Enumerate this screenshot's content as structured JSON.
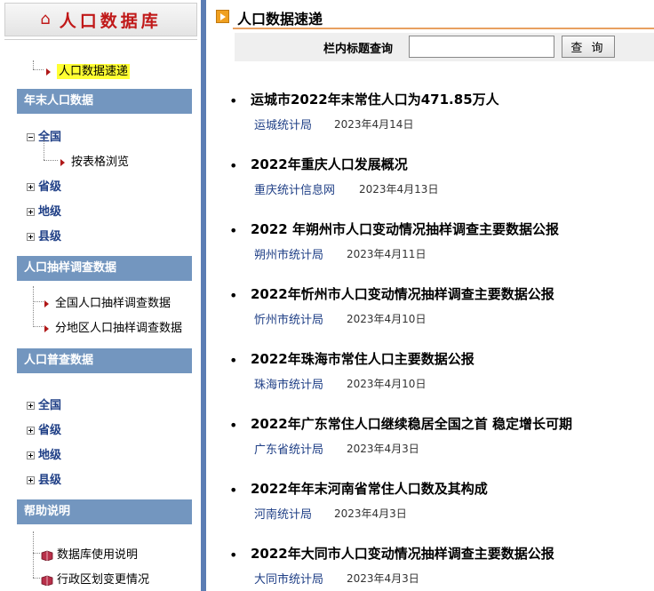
{
  "sidebar": {
    "logo_title": "人口数据库",
    "quick_link": "人口数据速递",
    "sections": {
      "year_end": "年末人口数据",
      "sample_survey": "人口抽样调查数据",
      "census": "人口普查数据",
      "help": "帮助说明"
    },
    "year_end_items": {
      "national": "全国",
      "table_browse": "按表格浏览",
      "province": "省级",
      "prefecture": "地级",
      "county": "县级"
    },
    "survey_items": {
      "national": "全国人口抽样调查数据",
      "regional": "分地区人口抽样调查数据"
    },
    "census_items": {
      "national": "全国",
      "province": "省级",
      "prefecture": "地级",
      "county": "县级"
    },
    "help_items": {
      "usage": "数据库使用说明",
      "admin_changes": "行政区划变更情况"
    }
  },
  "main": {
    "title": "人口数据速递",
    "search": {
      "label": "栏内标题查询",
      "value": "",
      "button": "查 询"
    },
    "news": [
      {
        "headline": "运城市2022年末常住人口为471.85万人",
        "source": "运城统计局",
        "date": "2023年4月14日"
      },
      {
        "headline": "2022年重庆人口发展概况",
        "source": "重庆统计信息网",
        "date": "2023年4月13日"
      },
      {
        "headline": "2022 年朔州市人口变动情况抽样调查主要数据公报",
        "source": "朔州市统计局",
        "date": "2023年4月11日"
      },
      {
        "headline": "2022年忻州市人口变动情况抽样调查主要数据公报",
        "source": "忻州市统计局",
        "date": "2023年4月10日"
      },
      {
        "headline": "2022年珠海市常住人口主要数据公报",
        "source": "珠海市统计局",
        "date": "2023年4月10日"
      },
      {
        "headline": "2022年广东常住人口继续稳居全国之首 稳定增长可期",
        "source": "广东省统计局",
        "date": "2023年4月3日"
      },
      {
        "headline": "2022年年末河南省常住人口数及其构成",
        "source": "河南统计局",
        "date": "2023年4月3日"
      },
      {
        "headline": "2022年大同市人口变动情况抽样调查主要数据公报",
        "source": "大同市统计局",
        "date": "2023年4月3日"
      }
    ]
  },
  "colors": {
    "section_bg": "#7396bf",
    "sidebar_border": "#5b7db4",
    "logo_text": "#c01818",
    "link_blue": "#1f3f86",
    "highlight": "#ffff33"
  },
  "icons": [
    "home-icon",
    "triangle-arrow-icon",
    "tree-plus-icon",
    "tree-minus-icon",
    "book-icon",
    "orange-arrow-icon"
  ]
}
